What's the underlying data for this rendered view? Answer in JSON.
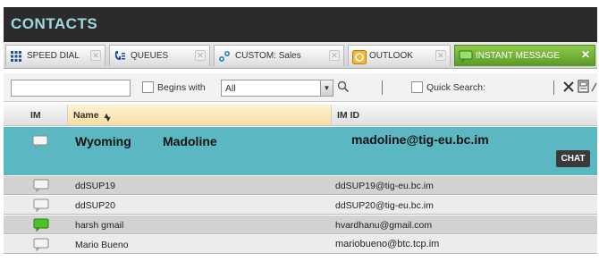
{
  "panel": {
    "title": "CONTACTS"
  },
  "tabs": [
    {
      "label": "SPEED DIAL",
      "icon": "speed-dial-grid-icon"
    },
    {
      "label": "QUEUES",
      "icon": "queue-icon"
    },
    {
      "label": "CUSTOM: Sales",
      "icon": "custom-group-icon"
    },
    {
      "label": "OUTLOOK",
      "icon": "outlook-icon"
    },
    {
      "label": "INSTANT MESSAGE",
      "icon": "instant-message-icon",
      "active": true
    }
  ],
  "toolbar": {
    "search_value": "",
    "begins_with_label": "Begins with",
    "filter_value": "All",
    "quick_search_label": "Quick Search:"
  },
  "columns": {
    "im": "IM",
    "name": "Name",
    "im_id": "IM ID"
  },
  "selected_contact": {
    "first_name": "Wyoming",
    "last_name": "Madoline",
    "im_id": "madoline@tig-eu.bc.im",
    "chat_label": "CHAT"
  },
  "rows": [
    {
      "name": "ddSUP19",
      "im_id": "ddSUP19@tig-eu.bc.im",
      "status": "offline"
    },
    {
      "name": "ddSUP20",
      "im_id": "ddSUP20@tig-eu.bc.im",
      "status": "offline"
    },
    {
      "name": "harsh gmail",
      "im_id": "hvardhanu@gmail.com",
      "status": "online"
    },
    {
      "name": "Mario Bueno",
      "im_id": "mariobueno@btc.tcp.im",
      "status": "offline"
    }
  ],
  "colors": {
    "title_bg": "#2b2b2b",
    "title_text": "#9fd8de",
    "selected_row": "#5bb7c1",
    "active_tab": "#6fb036",
    "online": "#3aa21e"
  }
}
